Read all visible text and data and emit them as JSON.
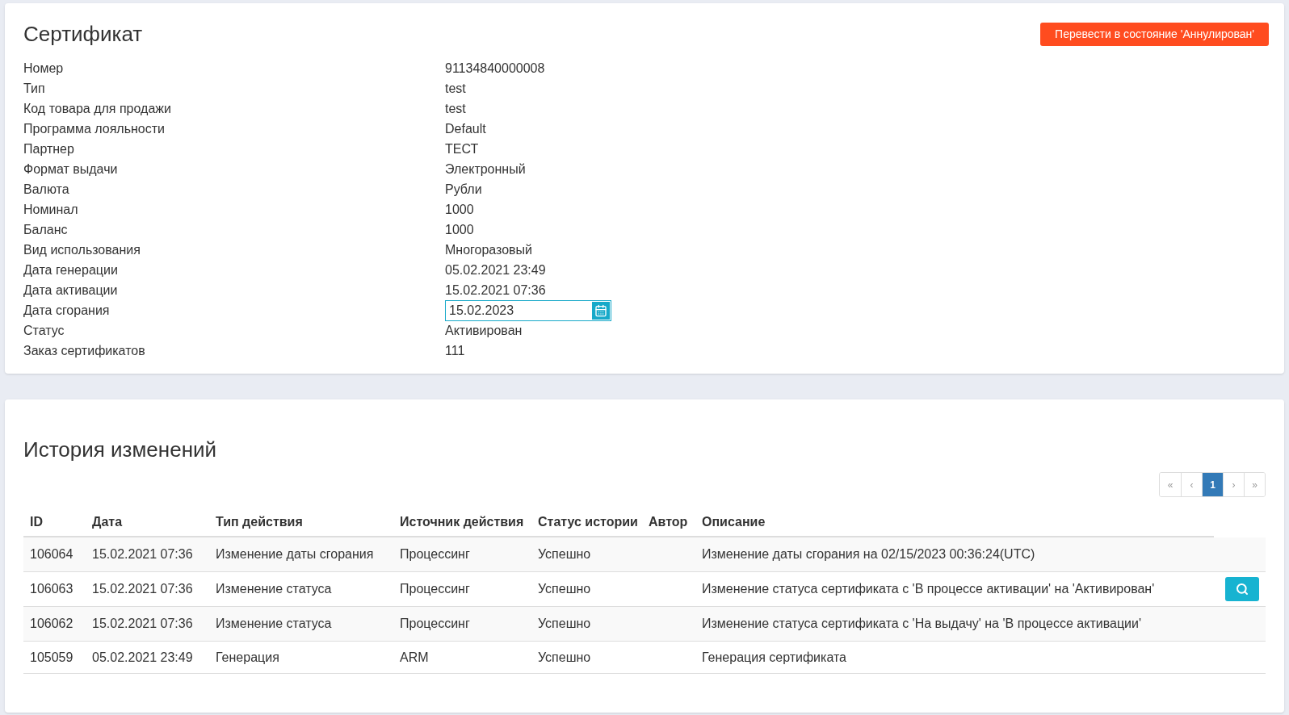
{
  "certificate": {
    "title": "Сертификат",
    "annul_button": "Перевести в состояние 'Аннулирован'",
    "fields": [
      {
        "label": "Номер",
        "value": "91134840000008",
        "kind": "text"
      },
      {
        "label": "Тип",
        "value": "test",
        "kind": "text"
      },
      {
        "label": "Код товара для продажи",
        "value": "test",
        "kind": "text"
      },
      {
        "label": "Программа лояльности",
        "value": "Default",
        "kind": "text"
      },
      {
        "label": "Партнер",
        "value": "ТЕСТ",
        "kind": "text"
      },
      {
        "label": "Формат выдачи",
        "value": "Электронный",
        "kind": "text"
      },
      {
        "label": "Валюта",
        "value": "Рубли",
        "kind": "text"
      },
      {
        "label": "Номинал",
        "value": "1000",
        "kind": "text"
      },
      {
        "label": "Баланс",
        "value": "1000",
        "kind": "text"
      },
      {
        "label": "Вид использования",
        "value": "Многоразовый",
        "kind": "text"
      },
      {
        "label": "Дата генерации",
        "value": "05.02.2021 23:49",
        "kind": "text"
      },
      {
        "label": "Дата активации",
        "value": "15.02.2021 07:36",
        "kind": "text"
      },
      {
        "label": "Дата сгорания",
        "value": "15.02.2023",
        "kind": "date"
      },
      {
        "label": "Статус",
        "value": "Активирован",
        "kind": "text"
      },
      {
        "label": "Заказ сертификатов",
        "value": "111",
        "kind": "text"
      }
    ]
  },
  "history": {
    "title": "История изменений",
    "pagination": [
      {
        "label": "«",
        "selected": false
      },
      {
        "label": "‹",
        "selected": false
      },
      {
        "label": "1",
        "selected": true
      },
      {
        "label": "›",
        "selected": false
      },
      {
        "label": "»",
        "selected": false
      }
    ],
    "columns": [
      "ID",
      "Дата",
      "Тип действия",
      "Источник действия",
      "Статус истории",
      "Автор",
      "Описание"
    ],
    "rows": [
      {
        "cells": [
          "106064",
          "15.02.2021 07:36",
          "Изменение даты сгорания",
          "Процессинг",
          "Успешно",
          "",
          "Изменение даты сгорания на 02/15/2023 00:36:24(UTC)"
        ],
        "details_button": false
      },
      {
        "cells": [
          "106063",
          "15.02.2021 07:36",
          "Изменение статуса",
          "Процессинг",
          "Успешно",
          "",
          "Изменение статуса сертификата с 'В процессе активации' на 'Активирован'"
        ],
        "details_button": true
      },
      {
        "cells": [
          "106062",
          "15.02.2021 07:36",
          "Изменение статуса",
          "Процессинг",
          "Успешно",
          "",
          "Изменение статуса сертификата с 'На выдачу' на 'В процессе активации'"
        ],
        "details_button": false
      },
      {
        "cells": [
          "105059",
          "05.02.2021 23:49",
          "Генерация",
          "ARM",
          "Успешно",
          "",
          "Генерация сертификата"
        ],
        "details_button": false
      }
    ]
  }
}
